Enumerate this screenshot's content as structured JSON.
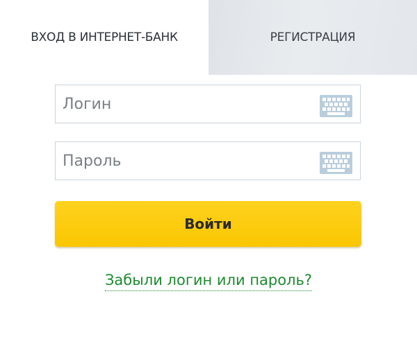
{
  "tabs": [
    {
      "label": "ВХОД В ИНТЕРНЕТ-БАНК",
      "active": true
    },
    {
      "label": "РЕГИСТРАЦИЯ",
      "active": false
    }
  ],
  "login_field": {
    "placeholder": "Логин",
    "value": ""
  },
  "password_field": {
    "placeholder": "Пароль",
    "value": ""
  },
  "submit": {
    "label": "Войти"
  },
  "forgot_link": {
    "label": "Забыли логин или пароль?"
  },
  "icons": {
    "keyboard": "virtual-keyboard-icon"
  },
  "colors": {
    "button_yellow": "#fdcc0d",
    "link_green": "#1d8a2f",
    "field_border": "#c9d3dc",
    "keyboard_icon": "#b9cddd",
    "inactive_tab": "#e4e8ec"
  }
}
